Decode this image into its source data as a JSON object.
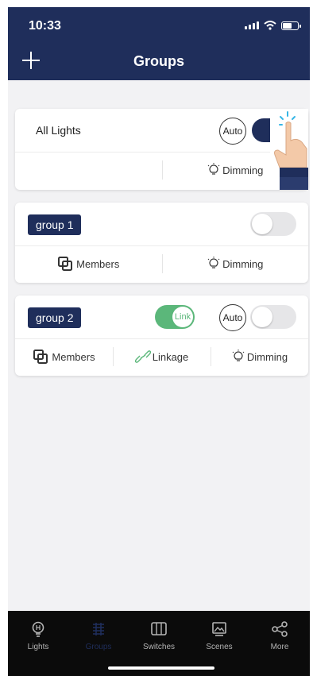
{
  "status": {
    "time": "10:33"
  },
  "header": {
    "title": "Groups",
    "add_icon": "plus-icon"
  },
  "cards": {
    "all_lights": {
      "name": "All Lights",
      "auto_label": "Auto",
      "dimming_label": "Dimming",
      "toggle_on": true
    },
    "group1": {
      "name": "group 1",
      "members_label": "Members",
      "dimming_label": "Dimming",
      "toggle_on": false
    },
    "group2": {
      "name": "group 2",
      "link_label": "Link",
      "auto_label": "Auto",
      "members_label": "Members",
      "linkage_label": "Linkage",
      "dimming_label": "Dimming",
      "toggle_on": false,
      "link_on": true
    }
  },
  "tabs": [
    {
      "label": "Lights",
      "icon": "bulb-icon"
    },
    {
      "label": "Groups",
      "icon": "groups-icon",
      "active": true
    },
    {
      "label": "Switches",
      "icon": "switch-icon"
    },
    {
      "label": "Scenes",
      "icon": "scene-icon"
    },
    {
      "label": "More",
      "icon": "share-icon"
    }
  ],
  "colors": {
    "navy": "#1f2e5b",
    "link_green": "#5bb77a",
    "tab_bar": "#0b0b0b"
  }
}
